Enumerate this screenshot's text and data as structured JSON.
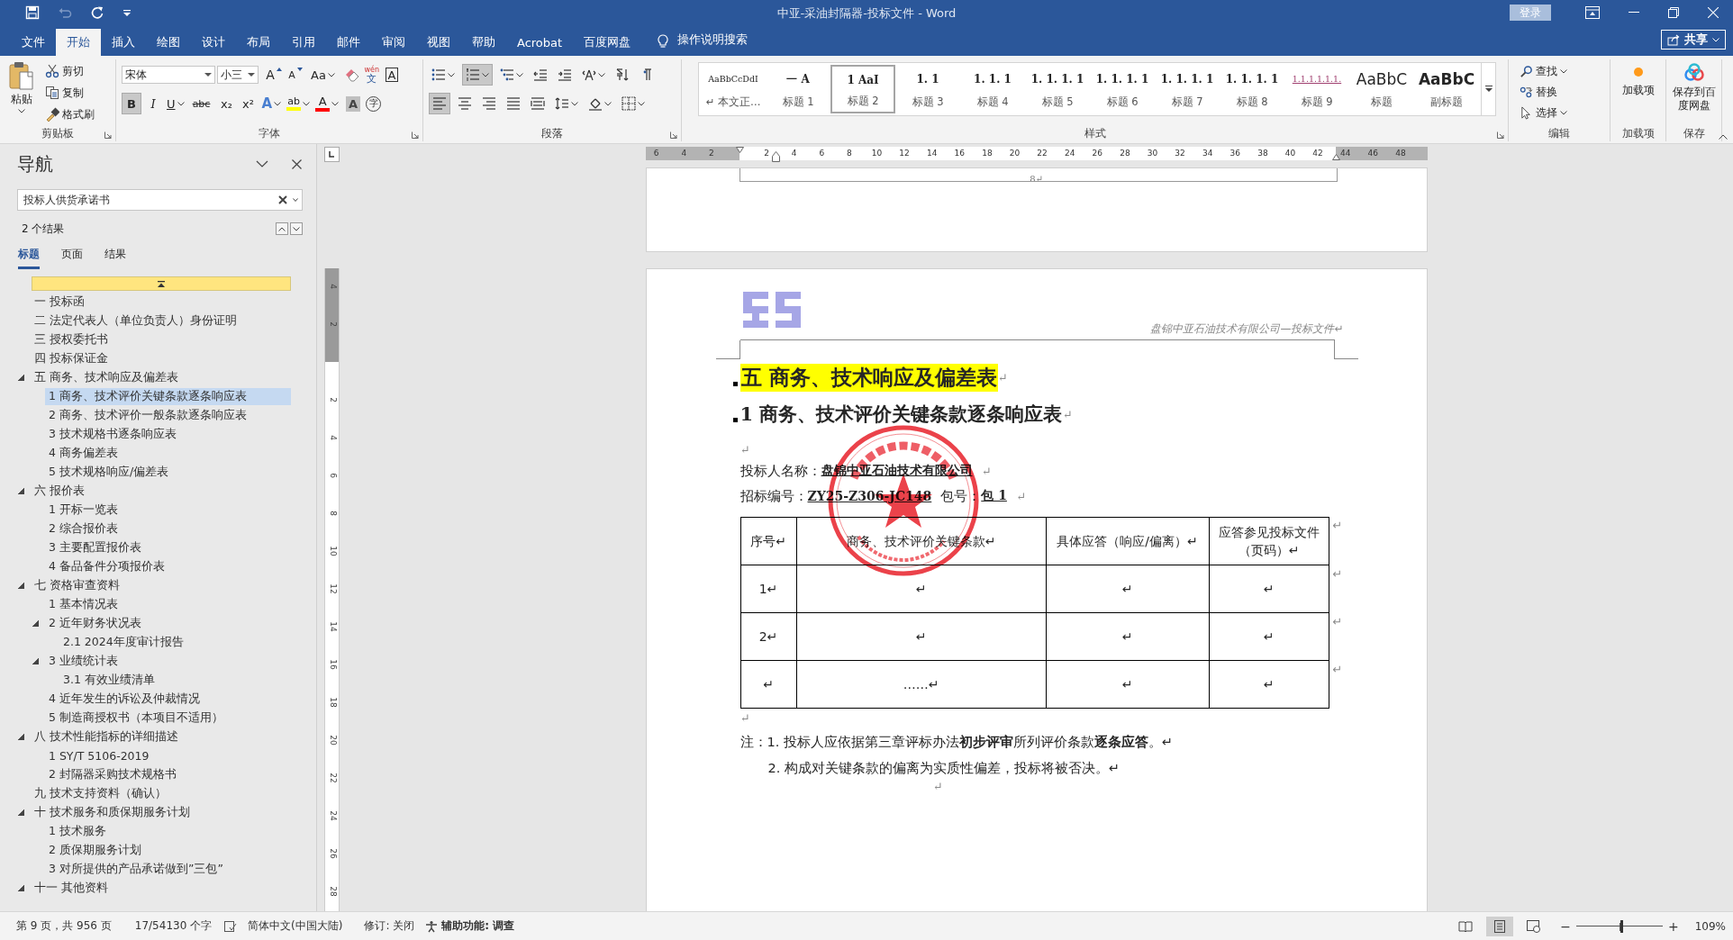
{
  "window": {
    "title": "中亚-采油封隔器-投标文件  -  Word",
    "login": "登录",
    "share": "共享"
  },
  "quick_access": [
    {
      "kind": "save",
      "disabled": false
    },
    {
      "kind": "undo",
      "disabled": true
    },
    {
      "kind": "redo",
      "disabled": false
    },
    {
      "kind": "customize",
      "disabled": false
    }
  ],
  "ribbon_tabs": [
    {
      "label": "文件",
      "selected": false
    },
    {
      "label": "开始",
      "selected": true
    },
    {
      "label": "插入",
      "selected": false
    },
    {
      "label": "绘图",
      "selected": false
    },
    {
      "label": "设计",
      "selected": false
    },
    {
      "label": "布局",
      "selected": false
    },
    {
      "label": "引用",
      "selected": false
    },
    {
      "label": "邮件",
      "selected": false
    },
    {
      "label": "审阅",
      "selected": false
    },
    {
      "label": "视图",
      "selected": false
    },
    {
      "label": "帮助",
      "selected": false
    },
    {
      "label": "Acrobat",
      "selected": false
    },
    {
      "label": "百度网盘",
      "selected": false
    }
  ],
  "tell_me": "操作说明搜索",
  "clipboard": {
    "label": "剪贴板",
    "paste": "粘贴",
    "items": [
      {
        "kind": "cut",
        "label": "剪切"
      },
      {
        "kind": "copy",
        "label": "复制"
      },
      {
        "kind": "format-painter",
        "label": "格式刷"
      }
    ]
  },
  "font": {
    "label": "字体",
    "name": "宋体",
    "size": "小三",
    "row1": [
      {
        "kind": "grow",
        "label": "A"
      },
      {
        "kind": "shrink",
        "label": "A"
      },
      {
        "kind": "dropdown",
        "label": "Aa"
      },
      {
        "kind": "clear"
      },
      {
        "kind": "phonetic",
        "label": "文",
        "ruby": "wén"
      },
      {
        "kind": "boxed",
        "label": "A"
      }
    ],
    "row2": [
      {
        "kind": "toggle",
        "label": "B",
        "on": true
      },
      {
        "kind": "toggle",
        "label": "I",
        "on": false
      },
      {
        "kind": "underline",
        "label": "U",
        "on": false
      },
      {
        "kind": "strike",
        "label": "abc",
        "on": false
      },
      {
        "kind": "toggle",
        "label": "x₂",
        "on": false
      },
      {
        "kind": "toggle",
        "label": "x²",
        "on": false
      },
      {
        "kind": "effect",
        "label": "A",
        "on": false
      },
      {
        "kind": "highlight",
        "label": "ab",
        "color": "#ffff00",
        "on": false
      },
      {
        "kind": "color",
        "label": "A",
        "color": "#ff0000",
        "on": false
      },
      {
        "kind": "shaded",
        "label": "A",
        "on": false
      },
      {
        "kind": "circled",
        "label": "字",
        "on": false
      }
    ]
  },
  "paragraph": {
    "label": "段落",
    "row1": [
      {
        "kind": "bullets",
        "on": false
      },
      {
        "kind": "numbering",
        "on": true
      },
      {
        "kind": "multilevel",
        "on": false
      },
      {
        "kind": "outdent",
        "on": false
      },
      {
        "kind": "indent",
        "on": false
      },
      {
        "kind": "cjk-layout",
        "on": false
      },
      {
        "kind": "sort",
        "on": false
      },
      {
        "kind": "marks",
        "on": false
      }
    ],
    "row2": [
      {
        "kind": "align-left",
        "on": true
      },
      {
        "kind": "align-center",
        "on": false
      },
      {
        "kind": "align-right",
        "on": false
      },
      {
        "kind": "justify",
        "on": false
      },
      {
        "kind": "distributed",
        "on": false
      },
      {
        "kind": "line-spacing",
        "on": false
      },
      {
        "kind": "shading",
        "on": false
      },
      {
        "kind": "borders",
        "on": false
      }
    ]
  },
  "styles": {
    "label": "样式",
    "items": [
      {
        "kind": "body",
        "preview": "AaBbCcDdI",
        "name": "↵ 本文正…",
        "selected": false
      },
      {
        "kind": "heading",
        "preview": "一  A",
        "name": "标题 1",
        "selected": false
      },
      {
        "kind": "heading",
        "preview": "1  AaI",
        "name": "标题 2",
        "selected": true
      },
      {
        "kind": "heading",
        "preview": "1. 1",
        "name": "标题 3",
        "selected": false
      },
      {
        "kind": "heading",
        "preview": "1. 1. 1",
        "name": "标题 4",
        "selected": false
      },
      {
        "kind": "heading",
        "preview": "1. 1. 1. 1",
        "name": "标题 5",
        "selected": false
      },
      {
        "kind": "heading",
        "preview": "1. 1. 1. 1",
        "name": "标题 6",
        "selected": false
      },
      {
        "kind": "heading",
        "preview": "1. 1. 1. 1",
        "name": "标题 7",
        "selected": false
      },
      {
        "kind": "heading",
        "preview": "1. 1. 1. 1",
        "name": "标题 8",
        "selected": false
      },
      {
        "kind": "numbered",
        "preview": "1.1.1.1.1.1.",
        "name": "标题 9",
        "selected": false
      },
      {
        "kind": "title",
        "preview": "AaBbC",
        "name": "标题",
        "selected": false
      },
      {
        "kind": "subtitle",
        "preview": "AaBbC",
        "name": "副标题",
        "selected": false
      }
    ]
  },
  "editing": {
    "label": "编辑",
    "items": [
      {
        "kind": "find",
        "label": "查找"
      },
      {
        "kind": "replace",
        "label": "替换"
      },
      {
        "kind": "select",
        "label": "选择"
      }
    ]
  },
  "addins": {
    "label": "加载项",
    "button": "加载项"
  },
  "save": {
    "label": "保存",
    "button": "保存到百度网盘"
  },
  "nav": {
    "title": "导航",
    "search": {
      "value": "投标人供货承诺书"
    },
    "result_count": "2 个结果",
    "tabs": [
      {
        "label": "标题",
        "selected": true
      },
      {
        "label": "页面",
        "selected": false
      },
      {
        "label": "结果",
        "selected": false
      }
    ],
    "tree": [
      {
        "label": "一 投标函",
        "selected": false
      },
      {
        "label": "二 法定代表人（单位负责人）身份证明",
        "selected": false
      },
      {
        "label": "三 授权委托书",
        "selected": false
      },
      {
        "label": "四 投标保证金",
        "selected": false
      },
      {
        "label": "五 商务、技术响应及偏差表",
        "selected": false,
        "expanded": true,
        "children": [
          {
            "label": "1 商务、技术评价关键条款逐条响应表",
            "selected": true
          },
          {
            "label": "2 商务、技术评价一般条款逐条响应表",
            "selected": false
          },
          {
            "label": "3 技术规格书逐条响应表",
            "selected": false
          },
          {
            "label": "4 商务偏差表",
            "selected": false
          },
          {
            "label": "5 技术规格响应/偏差表",
            "selected": false
          }
        ]
      },
      {
        "label": "六 报价表",
        "selected": false,
        "expanded": true,
        "children": [
          {
            "label": "1 开标一览表",
            "selected": false
          },
          {
            "label": "2 综合报价表",
            "selected": false
          },
          {
            "label": "3 主要配置报价表",
            "selected": false
          },
          {
            "label": "4 备品备件分项报价表",
            "selected": false
          }
        ]
      },
      {
        "label": "七 资格审查资料",
        "selected": false,
        "expanded": true,
        "children": [
          {
            "label": "1 基本情况表",
            "selected": false
          },
          {
            "label": "2 近年财务状况表",
            "selected": false,
            "expanded": true,
            "children": [
              {
                "label": "2.1 2024年度审计报告",
                "selected": false
              }
            ]
          },
          {
            "label": "3 业绩统计表",
            "selected": false,
            "expanded": true,
            "children": [
              {
                "label": "3.1 有效业绩清单",
                "selected": false
              }
            ]
          },
          {
            "label": "4 近年发生的诉讼及仲裁情况",
            "selected": false
          },
          {
            "label": "5 制造商授权书（本项目不适用）",
            "selected": false
          }
        ]
      },
      {
        "label": "八 技术性能指标的详细描述",
        "selected": false,
        "expanded": true,
        "children": [
          {
            "label": "1 SY/T 5106-2019",
            "selected": false
          },
          {
            "label": "2 封隔器采购技术规格书",
            "selected": false
          }
        ]
      },
      {
        "label": "九 技术支持资料（确认）",
        "selected": false
      },
      {
        "label": "十 技术服务和质保期服务计划",
        "selected": false,
        "expanded": true,
        "children": [
          {
            "label": "1 技术服务",
            "selected": false
          },
          {
            "label": "2 质保期服务计划",
            "selected": false
          },
          {
            "label": "3 对所提供的产品承诺做到”三包”",
            "selected": false
          }
        ]
      },
      {
        "label": "十一 其他资料",
        "selected": false,
        "expanded": true
      }
    ]
  },
  "ruler": {
    "left_labels": [
      "6",
      "4",
      "2"
    ],
    "labels": [
      "2",
      "4",
      "6",
      "8",
      "10",
      "12",
      "14",
      "16",
      "18",
      "20",
      "22",
      "24",
      "26",
      "28",
      "30",
      "32",
      "34",
      "36",
      "38",
      "40",
      "42"
    ],
    "right_labels": [
      "44",
      "46",
      "48"
    ]
  },
  "vertical_ruler": {
    "top_labels": [
      "4",
      "2"
    ],
    "labels": [
      "2",
      "4",
      "6",
      "8",
      "10",
      "12",
      "14",
      "16",
      "18",
      "20",
      "22",
      "24",
      "26",
      "28"
    ]
  },
  "previous_page": {
    "page_number": "8↵"
  },
  "page": {
    "header": "盘锦中亚石油技术有限公司—投标文件↵",
    "heading1": {
      "text": "五 商务、技术响应及偏差表",
      "mark": "↵",
      "highlight": true
    },
    "heading2": {
      "text": "1 商务、技术评价关键条款逐条响应表",
      "mark": "↵"
    },
    "blank_mark": "↵",
    "fields": [
      {
        "parts": [
          {
            "kind": "label",
            "text": "投标人名称："
          },
          {
            "kind": "value",
            "text": "盘锦中亚石油技术有限公司"
          },
          {
            "kind": "mark",
            "text": "↵"
          }
        ]
      },
      {
        "parts": [
          {
            "kind": "label",
            "text": "招标编号："
          },
          {
            "kind": "value",
            "text": "ZY25-Z306-JC148"
          },
          {
            "kind": "label",
            "text": "包号："
          },
          {
            "kind": "value",
            "text": "包 1"
          },
          {
            "kind": "mark",
            "text": "↵"
          }
        ]
      }
    ],
    "table": {
      "columns": [
        "序号↵",
        "商务、技术评价关键条款↵",
        "具体应答（响应/偏离）↵",
        "应答参见投标文件（页码）↵"
      ],
      "header_end": "↵",
      "rows": [
        {
          "cells": [
            "1↵",
            "↵",
            "↵",
            "↵"
          ],
          "end": "↵"
        },
        {
          "cells": [
            "2↵",
            "↵",
            "↵",
            "↵"
          ],
          "end": "↵"
        },
        {
          "cells": [
            "↵",
            "……↵",
            "↵",
            "↵"
          ],
          "end": "↵"
        }
      ]
    },
    "after_table_mark": "↵",
    "notes": [
      "注：1. 投标人应依据第三章评标办法**初步评审**所列评价条款**逐条应答**。↵",
      "2. 构成对关键条款的偏离为实质性偏差，投标将被否决。↵"
    ],
    "end_mark": "↵"
  },
  "status_bar": {
    "page": "第 9 页，共 956 页",
    "words": "17/54130 个字",
    "language": "简体中文(中国大陆)",
    "track_changes": "修订: 关闭",
    "accessibility": "辅助功能: 调查",
    "views": [
      {
        "kind": "read",
        "selected": false
      },
      {
        "kind": "print",
        "selected": true
      },
      {
        "kind": "web",
        "selected": false
      }
    ],
    "zoom": {
      "minus": "−",
      "plus": "+",
      "level": 0.52,
      "reading": "109%"
    }
  }
}
